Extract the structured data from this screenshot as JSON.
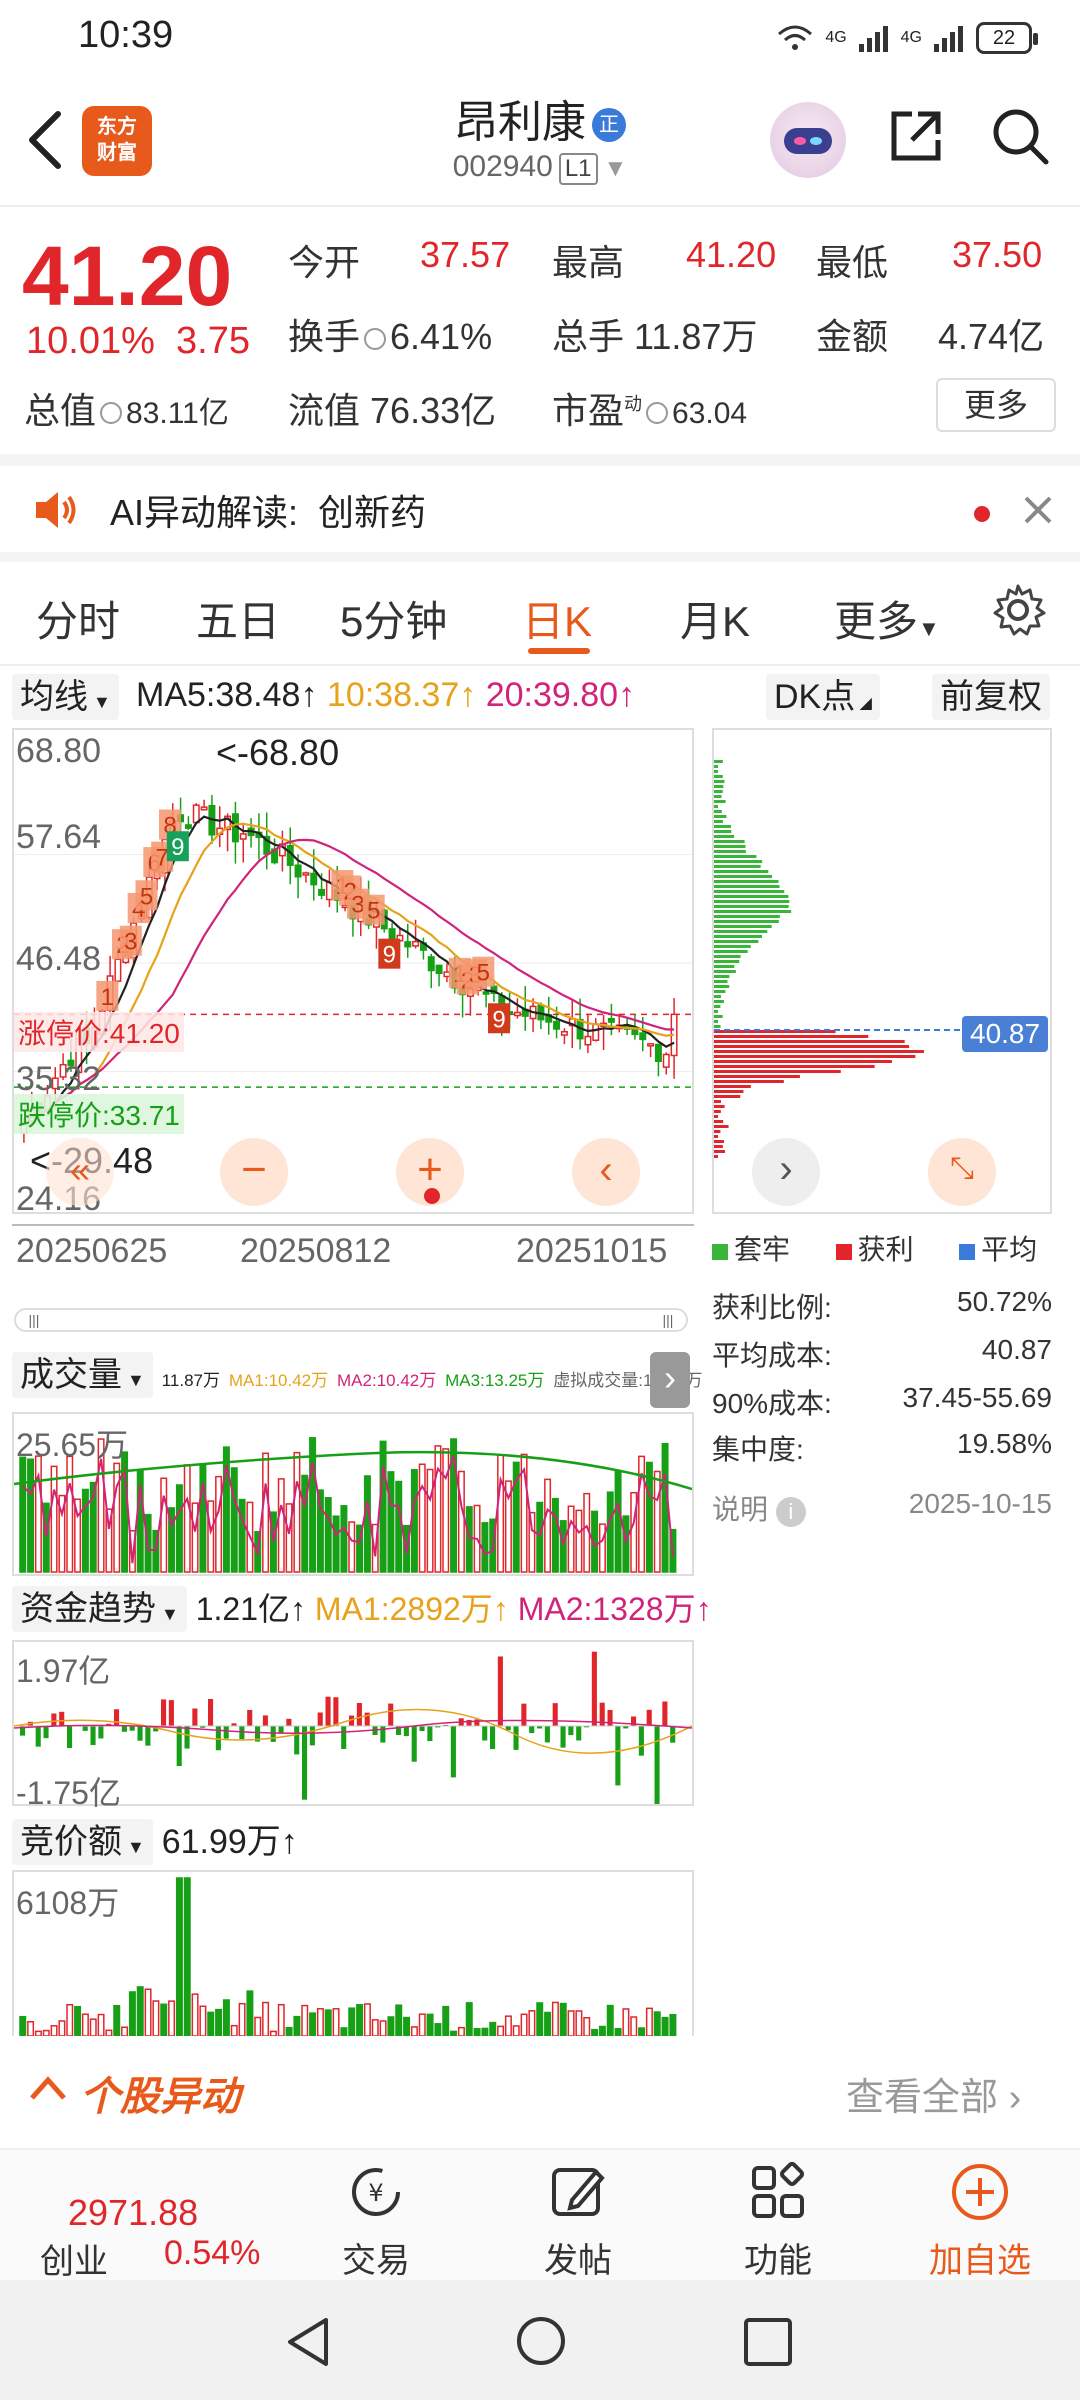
{
  "status_bar": {
    "time": "10:39",
    "signal1": "4G",
    "signal2": "4G",
    "battery": "22"
  },
  "header": {
    "logo_text": "东方\n财富",
    "stock_name": "昂利康",
    "stock_badge": "正",
    "stock_code": "002940",
    "level": "L1"
  },
  "quote": {
    "price": "41.20",
    "change_pct": "10.01%",
    "change_abs": "3.75",
    "open_label": "今开",
    "open": "37.57",
    "high_label": "最高",
    "high": "41.20",
    "low_label": "最低",
    "low": "37.50",
    "turnover_label": "换手",
    "turnover": "6.41%",
    "volume_label": "总手",
    "volume": "11.87万",
    "amount_label": "金额",
    "amount": "4.74亿",
    "mktcap_label": "总值",
    "mktcap": "83.11亿",
    "float_label": "流值",
    "float_cap": "76.33亿",
    "pe_label": "市盈",
    "pe_sup": "动",
    "pe": "63.04",
    "more_label": "更多"
  },
  "ai": {
    "label": "AI异动解读:",
    "topic": "创新药"
  },
  "tabs": [
    {
      "label": "分时"
    },
    {
      "label": "五日"
    },
    {
      "label": "5分钟"
    },
    {
      "label": "日K"
    },
    {
      "label": "月K"
    },
    {
      "label": "更多"
    }
  ],
  "kline": {
    "indicator_select": "均线",
    "ma5": "MA5:38.48↑",
    "ma10": "10:38.37↑",
    "ma20": "20:39.80↑",
    "dk_label": "DK点",
    "fq_label": "前复权",
    "y_labels": [
      "68.80",
      "57.64",
      "46.48",
      "35.32",
      "24.16"
    ],
    "max_marker": "<-68.80",
    "min_marker": "<-29.48",
    "limit_up_label": "涨停价:41.20",
    "limit_down_label": "跌停价:33.71",
    "x_labels": [
      "20250625",
      "20250812",
      "20251015"
    ],
    "colors": {
      "up": "#e0262b",
      "down": "#17a017",
      "ma5": "#222222",
      "ma10": "#e6a21a",
      "ma20": "#d0237a"
    }
  },
  "chip": {
    "avg_cost_tag": "40.87",
    "legend": [
      "套牢",
      "获利",
      "平均"
    ],
    "rows": [
      {
        "k": "获利比例:",
        "v": "50.72%"
      },
      {
        "k": "平均成本:",
        "v": "40.87"
      },
      {
        "k": "90%成本:",
        "v": "37.45-55.69"
      },
      {
        "k": "集中度:",
        "v": "19.58%"
      }
    ],
    "note_label": "说明",
    "date": "2025-10-15"
  },
  "volume": {
    "select": "成交量",
    "line": "11.87万",
    "ma1": "MA1:10.42万",
    "ma2": "MA2:10.42万",
    "ma3": "MA3:13.25万",
    "virtual": "虚拟成交量:16.29万",
    "max": "25.65万"
  },
  "capital": {
    "select": "资金趋势",
    "value": "1.21亿↑",
    "ma1": "MA1:2892万↑",
    "ma2": "MA2:1328万↑",
    "max": "1.97亿",
    "min": "-1.75亿"
  },
  "auction": {
    "select": "竞价额",
    "value": "61.99万↑",
    "max": "6108万"
  },
  "yidong": {
    "title": "个股异动",
    "view_all": "查看全部"
  },
  "bottom_nav": {
    "index_value": "2971.88",
    "index_name": "创业",
    "index_pct": "0.54%",
    "trade": "交易",
    "post": "发帖",
    "func": "功能",
    "add": "加自选"
  }
}
